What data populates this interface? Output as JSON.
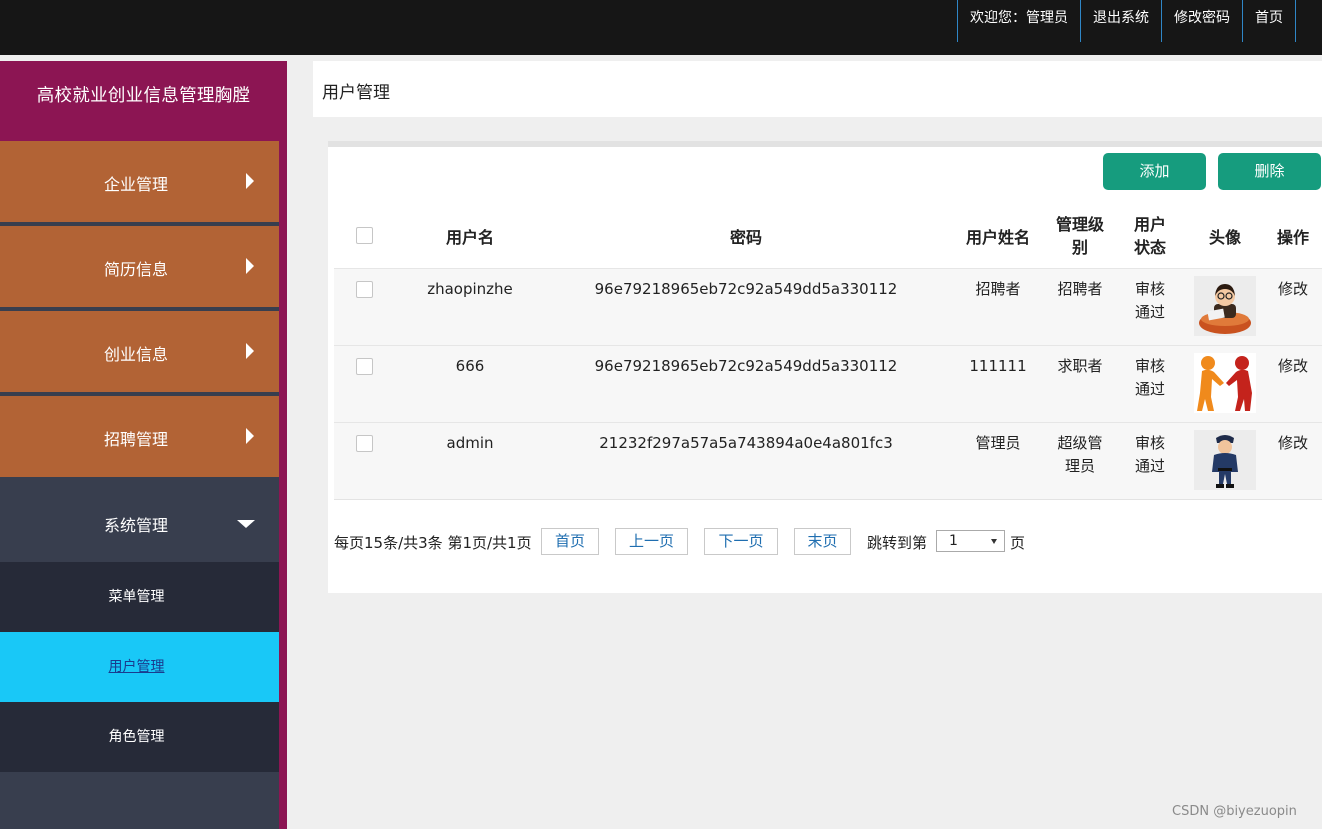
{
  "topnav": {
    "welcome": "欢迎您：管理员",
    "logout": "退出系统",
    "change_password": "修改密码",
    "home": "首页"
  },
  "sidebar": {
    "title": "高校就业创业信息管理胸膛",
    "items": [
      {
        "label": "企业管理"
      },
      {
        "label": "简历信息"
      },
      {
        "label": "创业信息"
      },
      {
        "label": "招聘管理"
      }
    ],
    "open_item": {
      "label": "系统管理"
    },
    "sub_items": [
      {
        "label": "菜单管理"
      },
      {
        "label": "用户管理"
      },
      {
        "label": "角色管理"
      }
    ]
  },
  "page": {
    "title": "用户管理"
  },
  "toolbar": {
    "add_label": "添加",
    "delete_label": "删除"
  },
  "table": {
    "headers": {
      "username": "用户名",
      "password": "密码",
      "realname": "用户姓名",
      "level": "管理级别",
      "status": "用户状态",
      "avatar": "头像",
      "action": "操作"
    },
    "rows": [
      {
        "username": "zhaopinzhe",
        "password": "96e79218965eb72c92a549dd5a330112",
        "realname": "招聘者",
        "level": "招聘者",
        "status": "审核通过",
        "avatar_icon": "recruiter-avatar-icon",
        "action": "修改"
      },
      {
        "username": "666",
        "password": "96e79218965eb72c92a549dd5a330112",
        "realname": "111111",
        "level": "求职者",
        "status": "审核通过",
        "avatar_icon": "handshake-avatar-icon",
        "action": "修改"
      },
      {
        "username": "admin",
        "password": "21232f297a57a5a743894a0e4a801fc3",
        "realname": "管理员",
        "level": "超级管理员",
        "status": "审核通过",
        "avatar_icon": "police-avatar-icon",
        "action": "修改"
      }
    ]
  },
  "pagination": {
    "summary": "每页15条/共3条 第1页/共1页",
    "first": "首页",
    "prev": "上一页",
    "next": "下一页",
    "last": "末页",
    "jump_prefix": "跳转到第",
    "jump_value": "1",
    "jump_suffix": "页"
  },
  "watermark": "CSDN @biyezuopin",
  "colors": {
    "topbar": "#161616",
    "sidebar_frame": "#8c1553",
    "menu_item": "#b26335",
    "active_sub": "#19c8f7",
    "button": "#169c7e"
  }
}
